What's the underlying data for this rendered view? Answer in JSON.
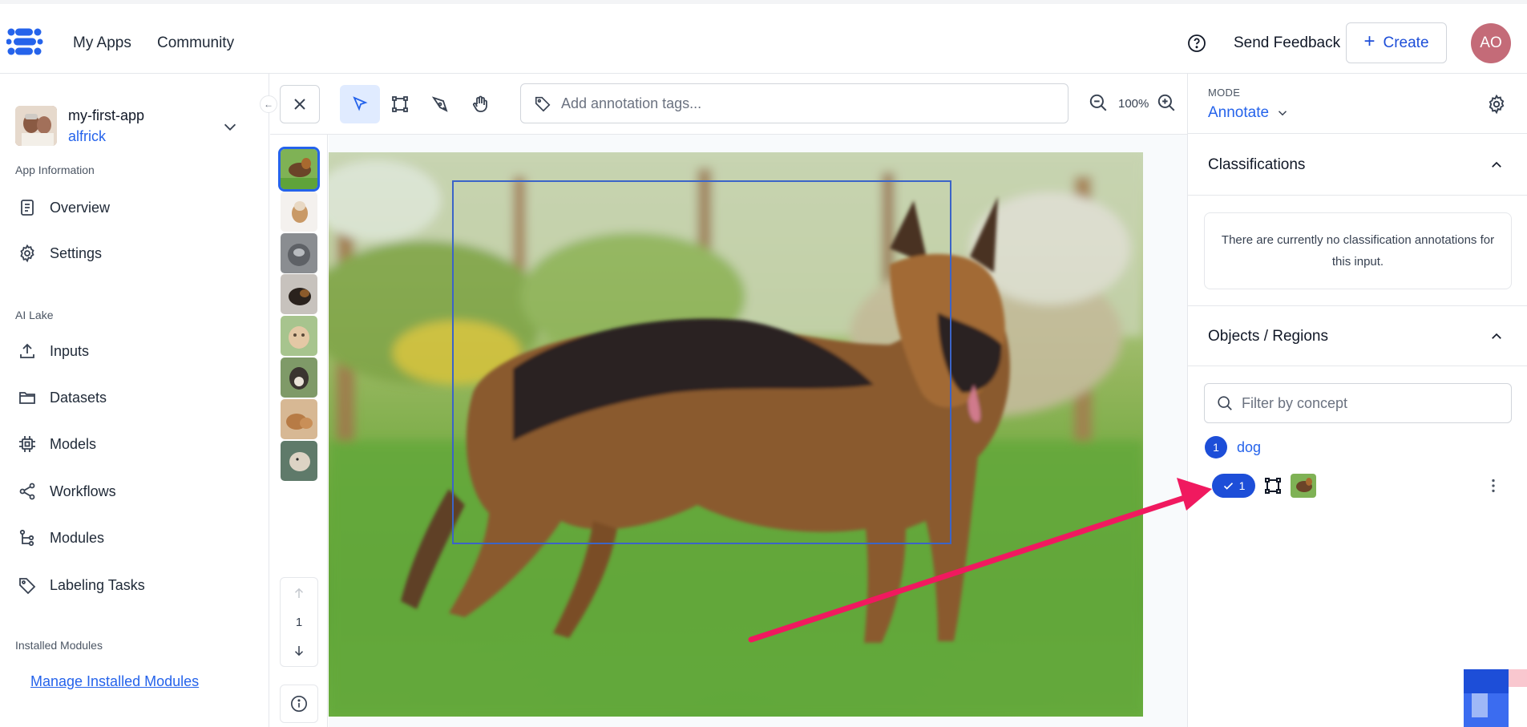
{
  "nav": {
    "links": [
      "My Apps",
      "Community"
    ],
    "send_feedback": "Send Feedback",
    "create_label": "Create",
    "avatar_initials": "AO",
    "brand_color": "#2563eb"
  },
  "sidebar": {
    "app_name": "my-first-app",
    "app_user": "alfrick",
    "section_app_info": "App Information",
    "app_info_items": [
      {
        "label": "Overview",
        "icon": "document-icon"
      },
      {
        "label": "Settings",
        "icon": "gear-icon"
      }
    ],
    "section_ai_lake": "AI Lake",
    "ai_lake_items": [
      {
        "label": "Inputs",
        "icon": "upload-icon"
      },
      {
        "label": "Datasets",
        "icon": "folder-icon"
      },
      {
        "label": "Models",
        "icon": "chip-icon"
      },
      {
        "label": "Workflows",
        "icon": "share-nodes-icon"
      },
      {
        "label": "Modules",
        "icon": "tree-icon"
      },
      {
        "label": "Labeling Tasks",
        "icon": "tag-icon"
      }
    ],
    "section_installed_modules": "Installed Modules",
    "manage_link": "Manage Installed Modules"
  },
  "toolbar": {
    "tags_placeholder": "Add annotation tags...",
    "zoom": "100%"
  },
  "thumbnails": {
    "count": 8,
    "selected_index": 0,
    "page": "1"
  },
  "canvas": {
    "box_label": "dog"
  },
  "right_panel": {
    "mode_label": "MODE",
    "mode_value": "Annotate",
    "classifications_title": "Classifications",
    "classifications_empty": "There are currently no classification annotations for this input.",
    "objects_title": "Objects / Regions",
    "filter_placeholder": "Filter by concept",
    "concepts": [
      {
        "count": "1",
        "name": "dog",
        "regions": [
          {
            "index": "1"
          }
        ]
      }
    ]
  }
}
